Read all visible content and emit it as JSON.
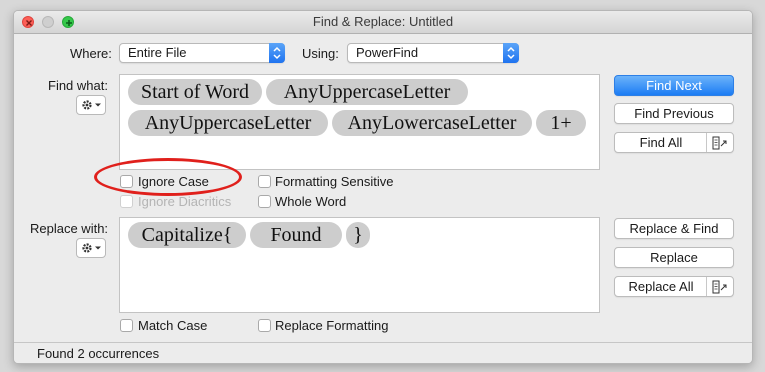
{
  "window": {
    "title": "Find & Replace: Untitled"
  },
  "where": {
    "label": "Where:",
    "value": "Entire File"
  },
  "using": {
    "label": "Using:",
    "value": "PowerFind"
  },
  "find": {
    "label": "Find what:",
    "tokens": [
      "Start of Word",
      "AnyUppercaseLetter",
      "AnyUppercaseLetter",
      "AnyLowercaseLetter",
      "1+"
    ]
  },
  "replace": {
    "label": "Replace with:",
    "tokens": [
      "Capitalize{",
      "Found",
      "}"
    ]
  },
  "options": {
    "ignore_case": "Ignore Case",
    "ignore_diacritics": "Ignore Diacritics",
    "formatting_sensitive": "Formatting Sensitive",
    "whole_word": "Whole Word",
    "match_case": "Match Case",
    "replace_formatting": "Replace Formatting"
  },
  "buttons": {
    "find_next": "Find Next",
    "find_previous": "Find Previous",
    "find_all": "Find All",
    "replace_find": "Replace & Find",
    "replace": "Replace",
    "replace_all": "Replace All"
  },
  "status": {
    "text": "Found 2 occurrences"
  },
  "icons": {
    "gear": "gear-icon",
    "popup_arrows": "chevron-updown-icon",
    "results_window": "open-results-window-icon"
  },
  "colors": {
    "accent": "#1c7cf4",
    "highlight": "#e0201c",
    "token": "#cdcdcd"
  }
}
